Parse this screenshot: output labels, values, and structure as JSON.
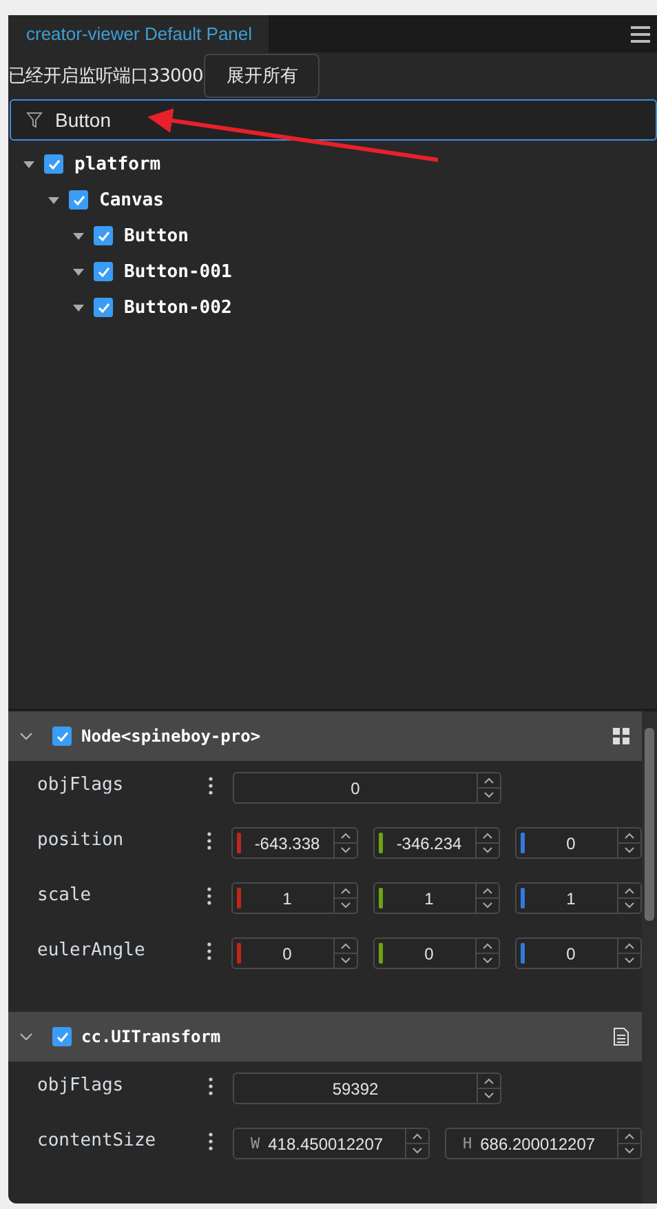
{
  "panel_tab": {
    "label": "creator-viewer Default Panel",
    "selected": true
  },
  "status_text": "已经开启监听端口33000",
  "expand_button": {
    "label": "展开所有"
  },
  "filter": {
    "value": "Button"
  },
  "tree": [
    {
      "name": "platform",
      "checked": true,
      "expanded": true,
      "children": [
        {
          "name": "Canvas",
          "checked": true,
          "expanded": true,
          "children": [
            {
              "name": "Button",
              "checked": true,
              "expanded": true
            },
            {
              "name": "Button-001",
              "checked": true,
              "expanded": true
            },
            {
              "name": "Button-002",
              "checked": true,
              "expanded": true
            }
          ]
        }
      ]
    }
  ],
  "components": [
    {
      "title": "Node<spineboy-pro>",
      "checked": true,
      "expanded": true,
      "properties": [
        {
          "name": "objFlags",
          "kind": "number",
          "values": [
            "0"
          ]
        },
        {
          "name": "position",
          "kind": "vec3",
          "values": [
            "-643.338",
            "-346.234",
            "0"
          ]
        },
        {
          "name": "scale",
          "kind": "vec3",
          "values": [
            "1",
            "1",
            "1"
          ]
        },
        {
          "name": "eulerAngle",
          "kind": "vec3",
          "values": [
            "0",
            "0",
            "0"
          ]
        }
      ]
    },
    {
      "title": "cc.UITransform",
      "checked": true,
      "expanded": true,
      "properties": [
        {
          "name": "objFlags",
          "kind": "number",
          "values": [
            "59392"
          ]
        },
        {
          "name": "contentSize",
          "kind": "size",
          "axes": [
            "W",
            "H"
          ],
          "values": [
            "418.450012207",
            "686.200012207"
          ]
        }
      ]
    }
  ]
}
